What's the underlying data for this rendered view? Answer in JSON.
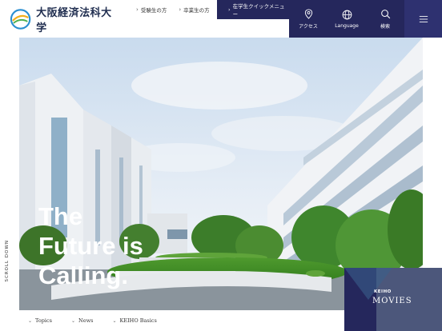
{
  "logo": {
    "name": "大阪経済法科大学",
    "icon": "university-emblem-icon"
  },
  "top_links": [
    {
      "label": "受験生の方",
      "icon": "chevron-right-icon"
    },
    {
      "label": "卒業生の方",
      "icon": "chevron-right-icon"
    }
  ],
  "intl_menu": {
    "label": "在学生クイックメニュー",
    "icon": "chevron-right-icon"
  },
  "nav": [
    {
      "label": "アクセス",
      "icon": "location-pin-icon"
    },
    {
      "label": "Language",
      "icon": "globe-icon"
    },
    {
      "label": "検索",
      "icon": "search-icon"
    }
  ],
  "menu_icon": "hamburger-menu-icon",
  "hero": {
    "title_lines": [
      "The",
      "Future is",
      "Calling."
    ],
    "side_text": "SCROLL DOWN"
  },
  "movies": {
    "kicker": "KEIHO",
    "title": "MOVIES"
  },
  "bottom_links": [
    {
      "label": "Topics",
      "icon": "chevron-down-icon"
    },
    {
      "label": "News",
      "icon": "chevron-down-icon"
    },
    {
      "label": "KEIHO Basics",
      "icon": "chevron-down-icon"
    }
  ],
  "colors": {
    "brand_navy": "#25275c",
    "sky": "#dfe9f3"
  }
}
